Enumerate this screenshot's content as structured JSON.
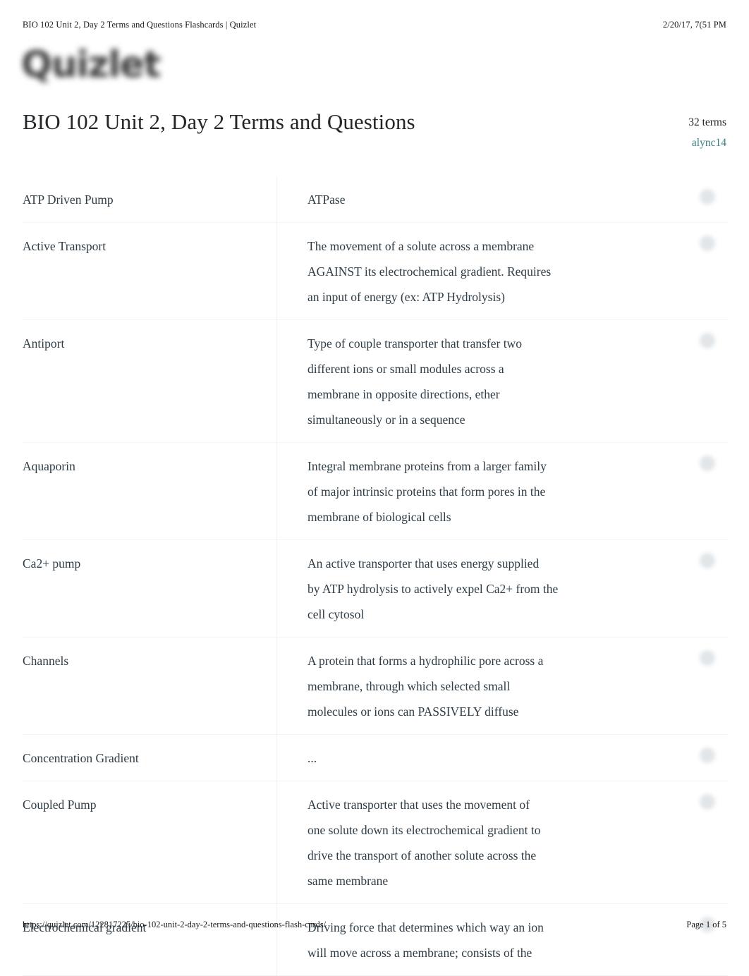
{
  "print_header": {
    "document_title": "BIO 102 Unit 2, Day 2 Terms and Questions Flashcards | Quizlet",
    "timestamp": "2/20/17, 7(51 PM"
  },
  "brand": {
    "logo_text": "Quizlet"
  },
  "set": {
    "title": "BIO 102 Unit 2, Day 2 Terms and Questions",
    "term_count": "32 terms",
    "author": "alync14",
    "author_link_color": "#3b7f86"
  },
  "cards": [
    {
      "term": "ATP Driven Pump",
      "definition": "ATPase",
      "icon": "audio-icon"
    },
    {
      "term": "Active Transport",
      "definition": "The movement of a solute across a membrane\nAGAINST its electrochemical gradient. Requires\nan input of energy (ex: ATP Hydrolysis)",
      "icon": "audio-icon"
    },
    {
      "term": "Antiport",
      "definition": "Type of couple transporter that transfer two\ndifferent ions or small modules across a\nmembrane in opposite directions, ether\nsimultaneously or in a sequence",
      "icon": "audio-icon"
    },
    {
      "term": "Aquaporin",
      "definition": "Integral membrane proteins from a larger family\nof major intrinsic proteins that form pores in the\nmembrane of biological cells",
      "icon": "audio-icon"
    },
    {
      "term": "Ca2+ pump",
      "definition": "An active transporter that uses energy supplied\nby ATP hydrolysis to actively expel Ca2+ from the\ncell cytosol",
      "icon": "audio-icon"
    },
    {
      "term": "Channels",
      "definition": "A protein that forms a hydrophilic pore across a\nmembrane, through which selected small\nmolecules or ions can PASSIVELY diffuse",
      "icon": "audio-icon"
    },
    {
      "term": "Concentration Gradient",
      "definition": "...",
      "icon": "audio-icon"
    },
    {
      "term": "Coupled Pump",
      "definition": "Active transporter that uses the movement of\none solute down its electrochemical gradient to\ndrive the transport of another solute across the\nsame membrane",
      "icon": "audio-icon"
    },
    {
      "term": "Electrochemical gradient",
      "definition": "Driving force that determines which way an ion\nwill move across a membrane; consists of the",
      "icon": "audio-icon"
    }
  ],
  "print_footer": {
    "url": "https://quizlet.com/122817225/bio-102-unit-2-day-2-terms-and-questions-flash-cards/",
    "page_label": "Page 1 of 5"
  }
}
